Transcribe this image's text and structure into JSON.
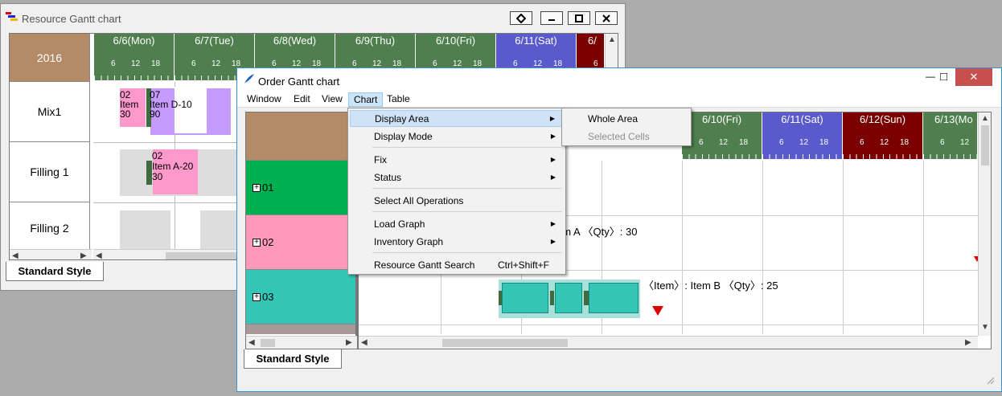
{
  "resource_window": {
    "title": "Resource Gantt chart",
    "year": "2016",
    "days": [
      {
        "label": "6/6(Mon)",
        "color": "#4f7f4f"
      },
      {
        "label": "6/7(Tue)",
        "color": "#4f7f4f"
      },
      {
        "label": "6/8(Wed)",
        "color": "#4f7f4f"
      },
      {
        "label": "6/9(Thu)",
        "color": "#4f7f4f"
      },
      {
        "label": "6/10(Fri)",
        "color": "#4f7f4f"
      },
      {
        "label": "6/11(Sat)",
        "color": "#5a5acd"
      },
      {
        "label": "6/",
        "color": "#7a0000"
      }
    ],
    "hours": [
      "6",
      "12",
      "18"
    ],
    "resources": [
      {
        "name": "Mix1",
        "color": "#ff8c5a"
      },
      {
        "name": "Filling 1",
        "color": "#66f2a2"
      },
      {
        "name": "Filling 2",
        "color": "#66f2a2"
      }
    ],
    "bars": [
      {
        "text_lines": [
          "02",
          "Item",
          "30"
        ]
      },
      {
        "text_lines": [
          "07",
          "Item D-10",
          "90"
        ]
      },
      {
        "text_lines": [
          "02",
          "Item A-20",
          "30"
        ]
      }
    ],
    "tab": "Standard Style",
    "icons": {
      "restore": "diamond-icon",
      "minimize": "minimize-icon",
      "maximize": "maximize-icon",
      "close": "close-icon"
    }
  },
  "order_window": {
    "title": "Order Gantt chart",
    "menubar": [
      "Window",
      "Edit",
      "View",
      "Chart",
      "Table"
    ],
    "days": [
      {
        "label": "6/10(Fri)",
        "color": "#4f7f4f"
      },
      {
        "label": "6/11(Sat)",
        "color": "#5a5acd"
      },
      {
        "label": "6/12(Sun)",
        "color": "#7a0000"
      },
      {
        "label": "6/13(Mo",
        "color": "#4f7f4f"
      }
    ],
    "hours": [
      "6",
      "12",
      "18"
    ],
    "orders": [
      {
        "name": "01",
        "color": "#00b050"
      },
      {
        "name": "02",
        "color": "#ff99bb"
      },
      {
        "name": "03",
        "color": "#33c6b6"
      }
    ],
    "order_labels": {
      "row2": "em A  〈Qty〉: 30",
      "row3": "〈Item〉: Item B  〈Qty〉: 25"
    },
    "tab": "Standard Style",
    "sysbuttons": {
      "min": "—",
      "max": "□",
      "close": "✕"
    }
  },
  "chart_menu": {
    "items": [
      {
        "label": "Display Area",
        "has_sub": true
      },
      {
        "label": "Display Mode",
        "has_sub": true
      },
      {
        "label": "Fix",
        "has_sub": true
      },
      {
        "label": "Status",
        "has_sub": true
      },
      {
        "label": "Select All Operations"
      },
      {
        "label": "Load Graph",
        "has_sub": true
      },
      {
        "label": "Inventory Graph",
        "has_sub": true
      },
      {
        "label": "Resource Gantt Search",
        "shortcut": "Ctrl+Shift+F"
      }
    ]
  },
  "display_area_submenu": {
    "items": [
      {
        "label": "Whole Area",
        "enabled": true
      },
      {
        "label": "Selected Cells",
        "enabled": false
      }
    ]
  }
}
